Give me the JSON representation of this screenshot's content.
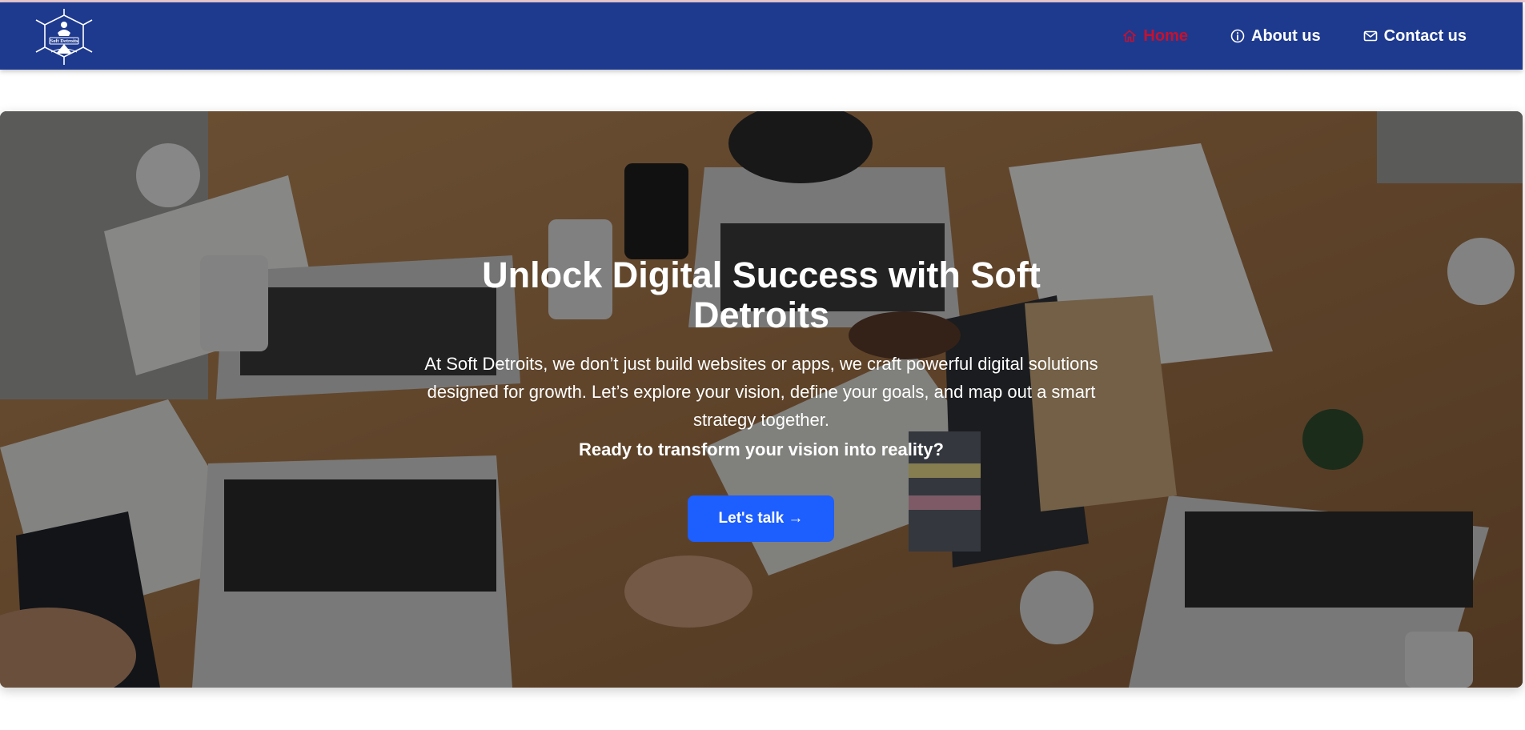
{
  "brand": {
    "logo_text": "Soft Detroits"
  },
  "nav": {
    "items": [
      {
        "label": "Home",
        "icon": "home-icon",
        "active": true
      },
      {
        "label": "About us",
        "icon": "info-icon",
        "active": false
      },
      {
        "label": "Contact us",
        "icon": "mail-icon",
        "active": false
      }
    ]
  },
  "hero": {
    "title": "Unlock Digital Success with Soft Detroits",
    "description": "At Soft Detroits, we don’t just build websites or apps, we craft powerful digital solutions designed for growth. Let’s explore your vision, define your goals, and map out a smart strategy together.",
    "cta_text": "Ready to transform your vision into reality?",
    "button_label": "Let's talk →"
  },
  "colors": {
    "navbar": "#1e3a8f",
    "active_link": "#c8102e",
    "button": "#1d5eff",
    "text_light": "#ffffff"
  }
}
